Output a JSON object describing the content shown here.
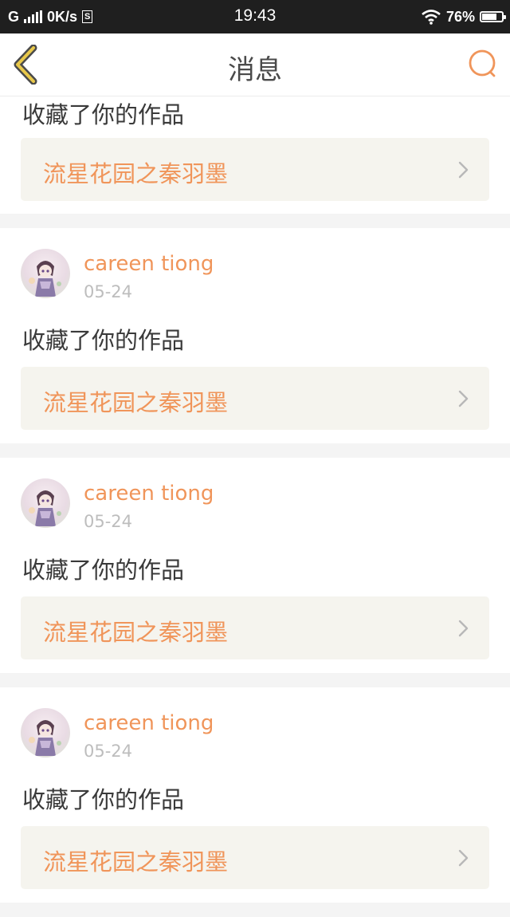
{
  "status_bar": {
    "network": "G",
    "speed": "0K/s",
    "speed_box": "S",
    "time": "19:43",
    "battery": "76%",
    "battery_level": 0.76
  },
  "nav": {
    "title": "消息",
    "back_icon": "chevron-left-icon",
    "search_icon": "search-icon"
  },
  "colors": {
    "accent": "#f0955a",
    "back_icon": "#e8c84a",
    "work_box_bg": "#f5f4ee",
    "separator": "#f4f4f4"
  },
  "first_item": {
    "action": "收藏了你的作品",
    "work_title": "流星花园之秦羽墨"
  },
  "items": [
    {
      "username": "careen tiong",
      "date": "05-24",
      "action": "收藏了你的作品",
      "work_title": "流星花园之秦羽墨"
    },
    {
      "username": "careen tiong",
      "date": "05-24",
      "action": "收藏了你的作品",
      "work_title": "流星花园之秦羽墨"
    },
    {
      "username": "careen tiong",
      "date": "05-24",
      "action": "收藏了你的作品",
      "work_title": "流星花园之秦羽墨"
    }
  ]
}
